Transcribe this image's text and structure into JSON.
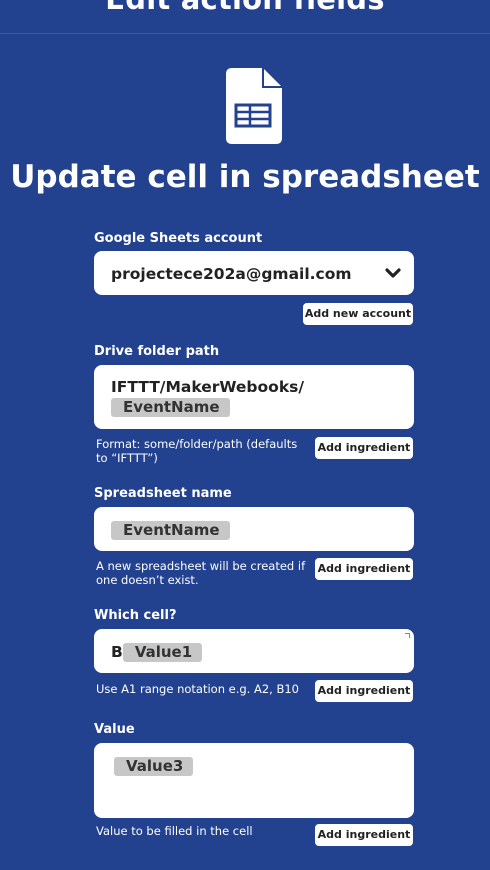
{
  "header": {
    "title": "Edit action fields"
  },
  "action": {
    "title": "Update cell in spreadsheet",
    "icon": "google-sheets-icon"
  },
  "account": {
    "label": "Google Sheets account",
    "value": "projectece202a@gmail.com",
    "add_button": "Add new account"
  },
  "drive_path": {
    "label": "Drive folder path",
    "text": "IFTTT/MakerWebooks/",
    "chip": "EventName",
    "help": "Format: some/folder/path (defaults to “IFTTT”)",
    "add_button": "Add ingredient"
  },
  "spreadsheet_name": {
    "label": "Spreadsheet name",
    "chip": "EventName",
    "help": "A new spreadsheet will be created if one doesn’t exist.",
    "add_button": "Add ingredient"
  },
  "which_cell": {
    "label": "Which cell?",
    "text": "B",
    "chip": "Value1",
    "help": "Use A1 range notation e.g. A2, B10",
    "add_button": "Add ingredient"
  },
  "value": {
    "label": "Value",
    "chip": "Value3",
    "help": "Value to be filled in the cell",
    "add_button": "Add ingredient"
  },
  "colors": {
    "background": "#22418f",
    "chip": "#c7c7c7",
    "field": "#ffffff"
  }
}
